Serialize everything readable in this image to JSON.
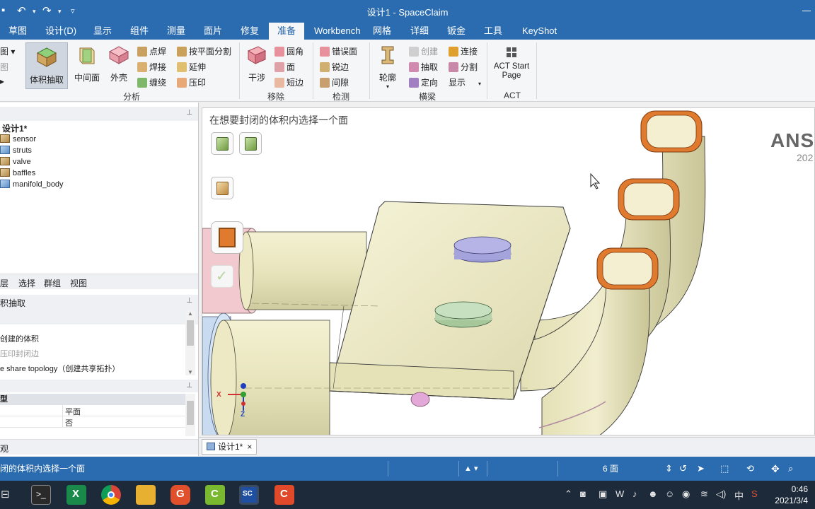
{
  "window": {
    "title": "设计1 - SpaceClaim"
  },
  "quick_access": {
    "undo_icon": "undo-icon",
    "redo_icon": "redo-icon",
    "customize": "▿"
  },
  "tabs": [
    {
      "label": "草图"
    },
    {
      "label": "设计(D)"
    },
    {
      "label": "显示"
    },
    {
      "label": "组件"
    },
    {
      "label": "测量"
    },
    {
      "label": "面片"
    },
    {
      "label": "修复"
    },
    {
      "label": "准备",
      "active": true
    },
    {
      "label": "Workbench"
    },
    {
      "label": "网格"
    },
    {
      "label": "详细"
    },
    {
      "label": "钣金"
    },
    {
      "label": "工具"
    },
    {
      "label": "KeyShot"
    }
  ],
  "ribbon": {
    "analysis": {
      "group_label": "分析",
      "volume_extract": "体积抽取",
      "mid_surface": "中间面",
      "shell": "外壳",
      "spot_weld": "点焊",
      "weld": "焊接",
      "wrap": "缠绕",
      "split_by_plane": "按平面分割",
      "extend": "延伸",
      "imprint": "压印"
    },
    "remove": {
      "group_label": "移除",
      "interference": "干涉",
      "rounds": "圆角",
      "faces": "面",
      "short_edges": "短边"
    },
    "detect": {
      "group_label": "检测",
      "misaligned_faces": "错误面",
      "sharp_edges": "锐边",
      "gaps": "间隙"
    },
    "beams": {
      "group_label": "横梁",
      "profile": "轮廓",
      "create": "创建",
      "extract": "抽取",
      "orient": "定向",
      "connect": "连接",
      "split": "分割",
      "display": "显示"
    },
    "act": {
      "group_label": "ACT",
      "start_page_line1": "ACT Start",
      "start_page_line2": "Page"
    }
  },
  "structure_tree": {
    "root": "设计1*",
    "items": [
      "sensor",
      "struts",
      "valve",
      "baffles",
      "manifold_body"
    ]
  },
  "panel_tabs": [
    "层",
    "选择",
    "群组",
    "视图"
  ],
  "options_panel": {
    "title": "积抽取",
    "options": [
      "创建的体积",
      "压印封闭边",
      "e share topology（创建共享拓扑）"
    ]
  },
  "properties": {
    "header": "型",
    "rows": [
      {
        "value": "平面"
      },
      {
        "value": "否"
      }
    ],
    "footer": "观"
  },
  "viewport": {
    "prompt": "在想要封闭的体积内选择一个面",
    "watermark_line1": "ANS",
    "watermark_line2": "202",
    "axis_x": "X",
    "axis_z": "Z"
  },
  "document_tab": {
    "label": "设计1*"
  },
  "statusbar": {
    "message": "闭的体积内选择一个面",
    "selection_count": "6 面"
  },
  "taskbar": {
    "clock_time": "0:46",
    "clock_date": "2021/3/4",
    "ime": "中"
  },
  "colors": {
    "accent": "#2b6cb0",
    "taskbar": "#1d2a3a",
    "model_body": "#ecebc6",
    "model_edge": "#3a3a3a",
    "selected_face": "#e07a2e",
    "purple_boss": "#a5a3dc",
    "green_boss": "#b7d3ae",
    "pink_ring": "#f2c9cf",
    "blue_ring": "#c8dbf0"
  }
}
